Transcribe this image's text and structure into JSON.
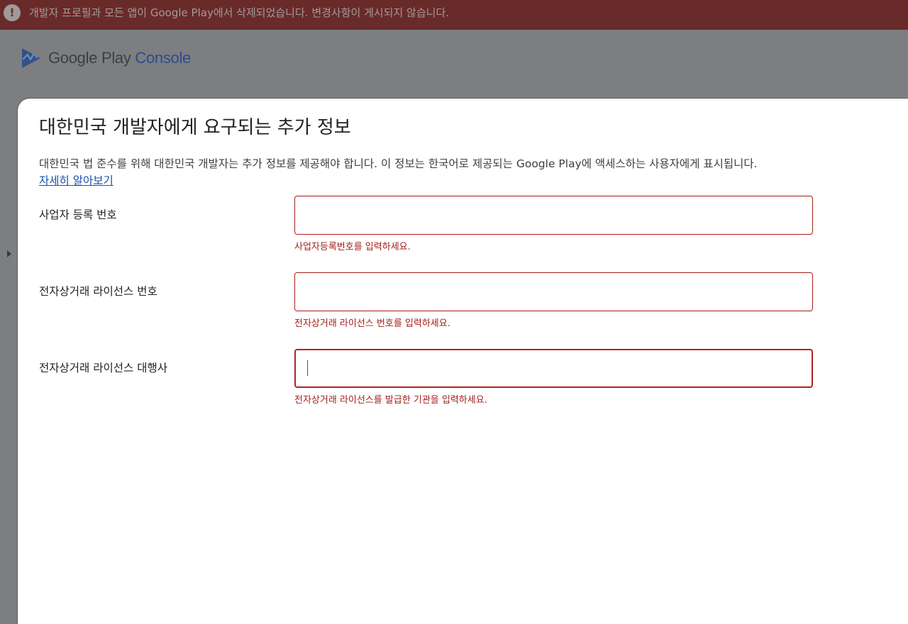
{
  "banner": {
    "icon": "alert-icon",
    "icon_glyph": "!",
    "message": "개발자 프로필과 모든 앱이 Google Play에서 삭제되었습니다. 변경사항이 게시되지 않습니다.",
    "color": "#692b29"
  },
  "brand": {
    "icon": "play-console-logo-icon",
    "google_play": "Google Play",
    "console": "Console"
  },
  "sidebar": {
    "toggle_icon": "chevron-right-icon"
  },
  "dialog": {
    "title": "대한민국 개발자에게 요구되는 추가 정보",
    "description": "대한민국 법 준수를 위해 대한민국 개발자는 추가 정보를 제공해야 합니다. 이 정보는 한국어로 제공되는 Google Play에 액세스하는 사용자에게 표시됩니다.",
    "learn_more": "자세히 알아보기",
    "fields": [
      {
        "label": "사업자 등록 번호",
        "value": "",
        "error": "사업자등록번호를 입력하세요."
      },
      {
        "label": "전자상거래 라이선스 번호",
        "value": "",
        "error": "전자상거래 라이선스 번호를 입력하세요."
      },
      {
        "label": "전자상거래 라이선스 대행사",
        "value": "",
        "error": "전자상거래 라이선스를 발급한 기관을 입력하세요."
      }
    ],
    "error_color": "#a31c16"
  }
}
